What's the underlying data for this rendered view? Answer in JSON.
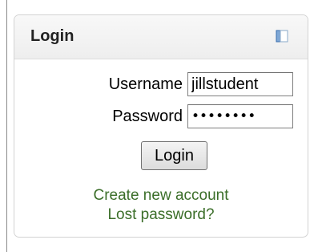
{
  "block": {
    "title": "Login",
    "dock_icon": "dock-block-icon"
  },
  "form": {
    "username_label": "Username",
    "username_value": "jillstudent",
    "password_label": "Password",
    "password_value": "••••••••",
    "login_button_label": "Login"
  },
  "links": {
    "create_account": "Create new account",
    "lost_password": "Lost password?"
  },
  "colors": {
    "link": "#3b6e29",
    "header_bg": "#f1f1f1",
    "border": "#d3d3d3"
  }
}
